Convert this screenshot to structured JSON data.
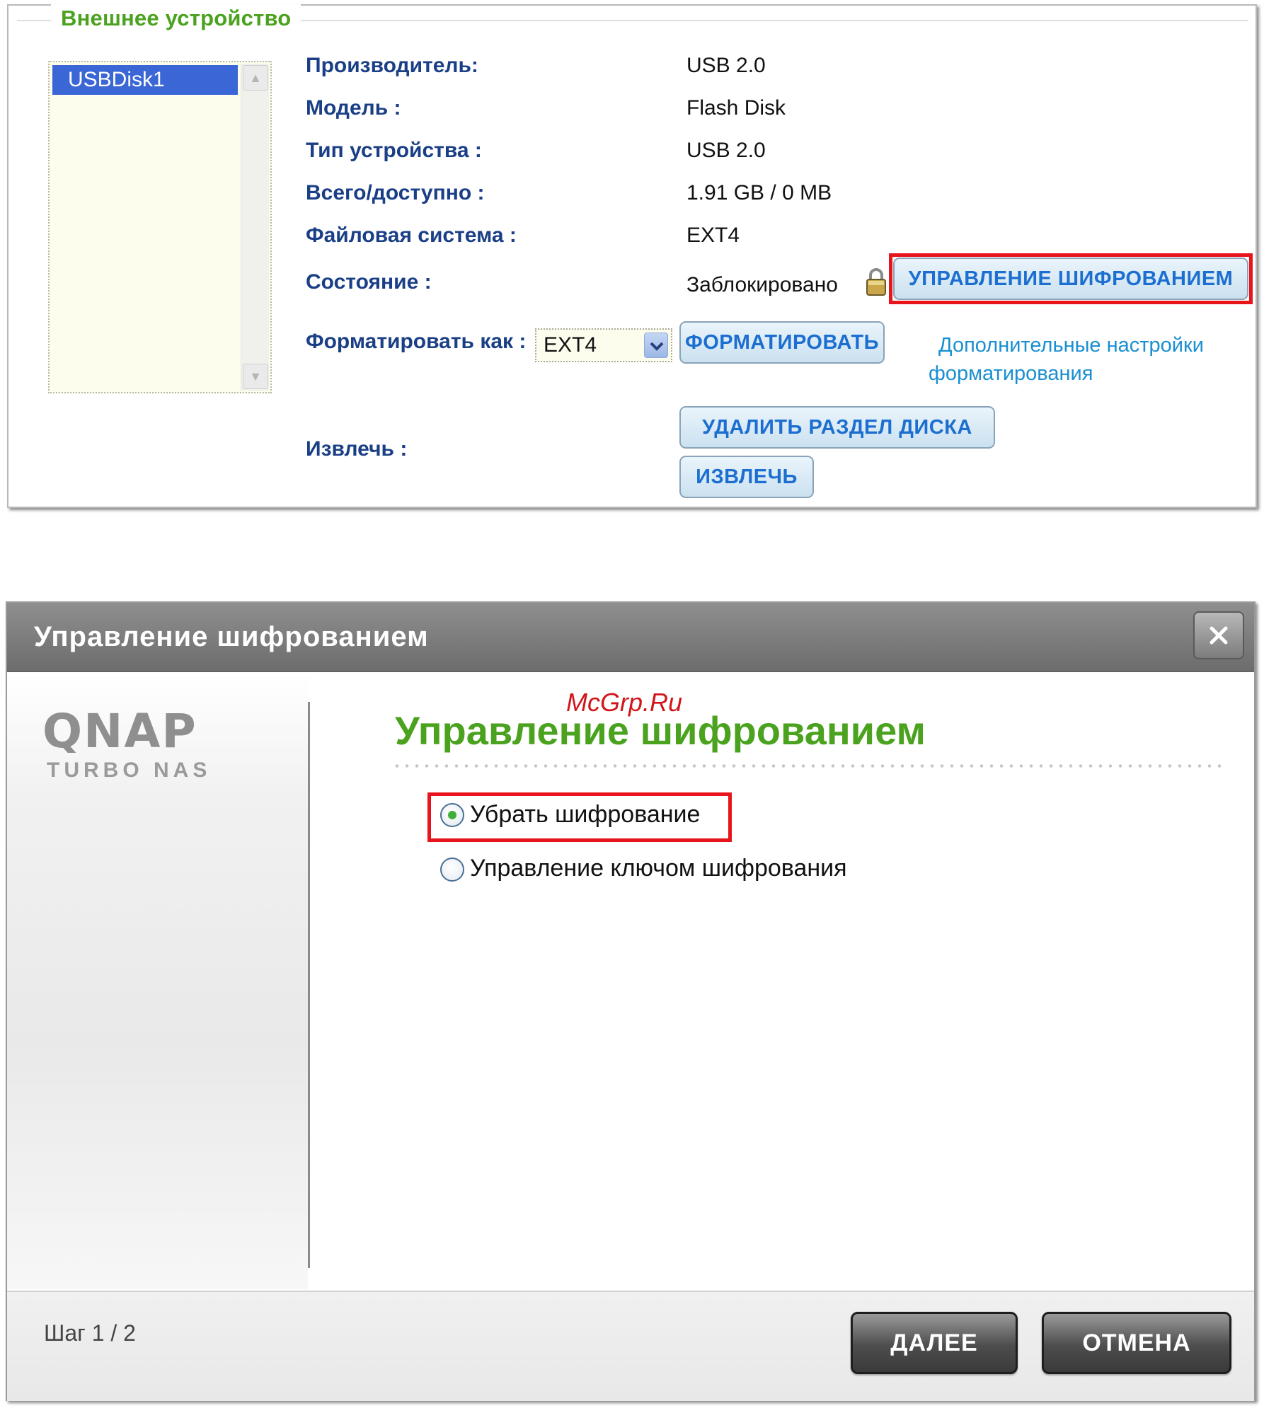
{
  "device_panel": {
    "title": "Внешнее устройство",
    "devices": [
      "USBDisk1"
    ],
    "fields": [
      {
        "label": "Производитель:",
        "value": "USB 2.0"
      },
      {
        "label": "Модель :",
        "value": "Flash Disk"
      },
      {
        "label": "Тип устройства :",
        "value": "USB 2.0"
      },
      {
        "label": "Всего/доступно :",
        "value": "1.91 GB / 0 MB"
      },
      {
        "label": "Файловая система :",
        "value": "EXT4"
      },
      {
        "label": "Состояние :",
        "value": "Заблокировано"
      }
    ],
    "encryption_button": "УПРАВЛЕНИЕ ШИФРОВАНИЕМ",
    "format_label": "Форматировать как :",
    "format_value": "EXT4",
    "format_button": "ФОРМАТИРОВАТЬ",
    "advanced_link": [
      "Дополнительные настройки",
      "форматирования"
    ],
    "eject_label": "Извлечь :",
    "delete_partition_button": "УДАЛИТЬ РАЗДЕЛ ДИСКА",
    "eject_button": "ИЗВЛЕЧЬ"
  },
  "dialog": {
    "title": "Управление шифрованием",
    "logo": "QNAP",
    "logo_sub": "TURBO NAS",
    "watermark": "McGrp.Ru",
    "heading": "Управление шифрованием",
    "options": [
      {
        "label": "Убрать шифрование",
        "selected": true
      },
      {
        "label": "Управление ключом шифрования",
        "selected": false
      }
    ],
    "step": "Шаг 1 / 2",
    "next_button": "ДАЛЕЕ",
    "cancel_button": "ОТМЕНА"
  },
  "colors": {
    "accent_green": "#4aa21e",
    "highlight_red": "#e8141b",
    "label_blue": "#1b3f86",
    "button_blue": "#1c6fd0"
  }
}
